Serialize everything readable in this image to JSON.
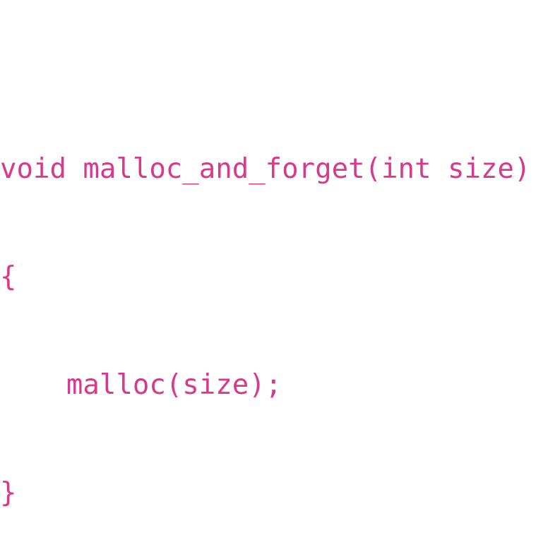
{
  "code": {
    "color": "#d63a8a",
    "lines": [
      "void malloc_and_forget(int size)",
      "{",
      "    malloc(size);",
      "}"
    ]
  }
}
